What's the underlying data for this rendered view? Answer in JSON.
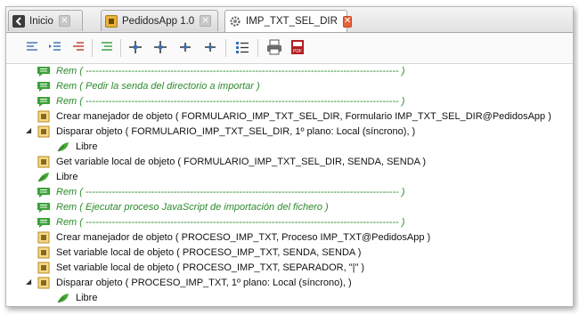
{
  "tabs": [
    {
      "label": "Inicio",
      "icon": "back-arrow-icon"
    },
    {
      "label": "PedidosApp 1.0",
      "icon": "app-icon"
    },
    {
      "label": "IMP_TXT_SEL_DIR",
      "icon": "gear-icon"
    }
  ],
  "toolbar": {
    "buttons": [
      "align-left-icon",
      "indent-icon",
      "outdent-red-icon",
      "indent-green-icon",
      "move-cursor-icon",
      "move-cursor-alt-icon",
      "move-left-icon",
      "move-right-icon",
      "list-icon",
      "print-icon",
      "pdf-icon"
    ]
  },
  "rows": [
    {
      "kind": "rem",
      "text": "Rem ( ------------------------------------------------------------------------------------------------ )"
    },
    {
      "kind": "rem",
      "text": "Rem ( Pedir la senda del directorio a importar )"
    },
    {
      "kind": "rem",
      "text": "Rem ( ------------------------------------------------------------------------------------------------ )"
    },
    {
      "kind": "cmd",
      "text": "Crear manejador de objeto ( FORMULARIO_IMP_TXT_SEL_DIR, Formulario IMP_TXT_SEL_DIR@PedidosApp )"
    },
    {
      "kind": "cmd",
      "text": "Disparar objeto ( FORMULARIO_IMP_TXT_SEL_DIR, 1º plano: Local (síncrono),  )"
    },
    {
      "kind": "libre",
      "text": "Libre"
    },
    {
      "kind": "cmd",
      "text": "Get variable local de objeto ( FORMULARIO_IMP_TXT_SEL_DIR, SENDA, SENDA )"
    },
    {
      "kind": "libre",
      "text": "Libre"
    },
    {
      "kind": "rem",
      "text": "Rem ( ------------------------------------------------------------------------------------------------ )"
    },
    {
      "kind": "rem",
      "text": "Rem ( Ejecutar proceso JavaScript de importación del fichero )"
    },
    {
      "kind": "rem",
      "text": "Rem ( ------------------------------------------------------------------------------------------------ )"
    },
    {
      "kind": "cmd",
      "text": "Crear manejador de objeto ( PROCESO_IMP_TXT, Proceso IMP_TXT@PedidosApp )"
    },
    {
      "kind": "cmd",
      "text": "Set variable local de objeto ( PROCESO_IMP_TXT, SENDA, SENDA )"
    },
    {
      "kind": "cmd",
      "text": "Set variable local de objeto ( PROCESO_IMP_TXT, SEPARADOR, \"|\" )"
    },
    {
      "kind": "cmd",
      "text": "Disparar objeto ( PROCESO_IMP_TXT, 1º plano: Local (síncrono),  )"
    },
    {
      "kind": "libre",
      "text": "Libre"
    }
  ],
  "colors": {
    "rem": "#2c8a2c",
    "close_active": "#e4643c"
  }
}
